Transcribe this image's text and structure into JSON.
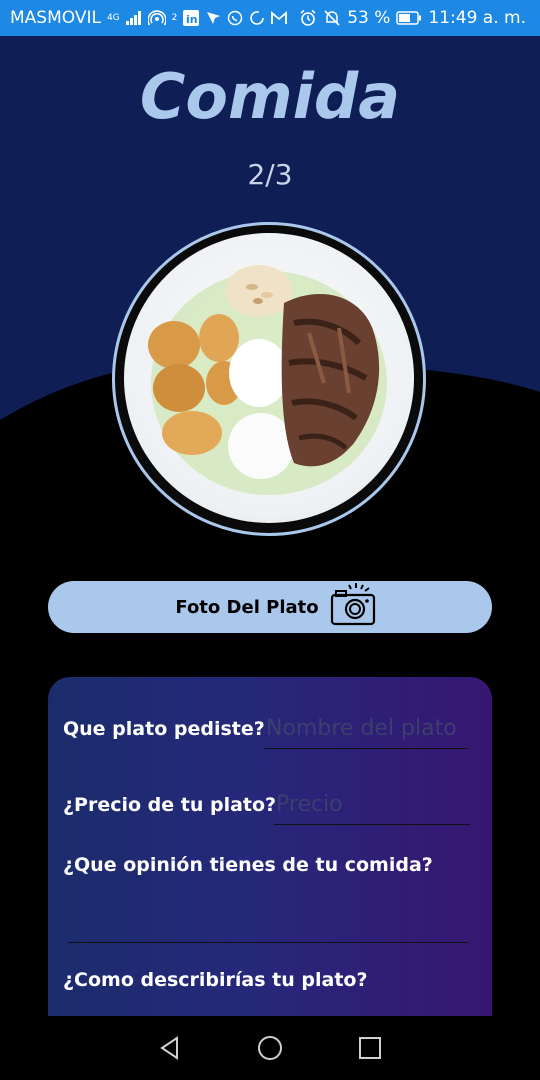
{
  "status_bar": {
    "carrier": "MASMOVIL",
    "network": "4G",
    "hotspot_count": "2",
    "battery": "53 %",
    "time": "11:49 a. m."
  },
  "header": {
    "title": "Comida",
    "counter": "2/3"
  },
  "photo_button": {
    "label": "Foto Del Plato",
    "icon": "camera-icon"
  },
  "form": {
    "dish_label": "Que plato pediste?",
    "dish_placeholder": "Nombre del plato",
    "price_label": "¿Precio de tu plato?",
    "price_placeholder": "Precio",
    "opinion_label": "¿Que opinión tienes de tu comida?",
    "describe_label": "¿Como describirías tu plato?"
  },
  "colors": {
    "status_bar": "#1e88e5",
    "header": "#0f1e54",
    "accent": "#a9c8ec",
    "card_start": "#1b2c6c",
    "card_end": "#371672"
  },
  "nav": {
    "back": "back-icon",
    "home": "home-icon",
    "recents": "recents-icon"
  }
}
